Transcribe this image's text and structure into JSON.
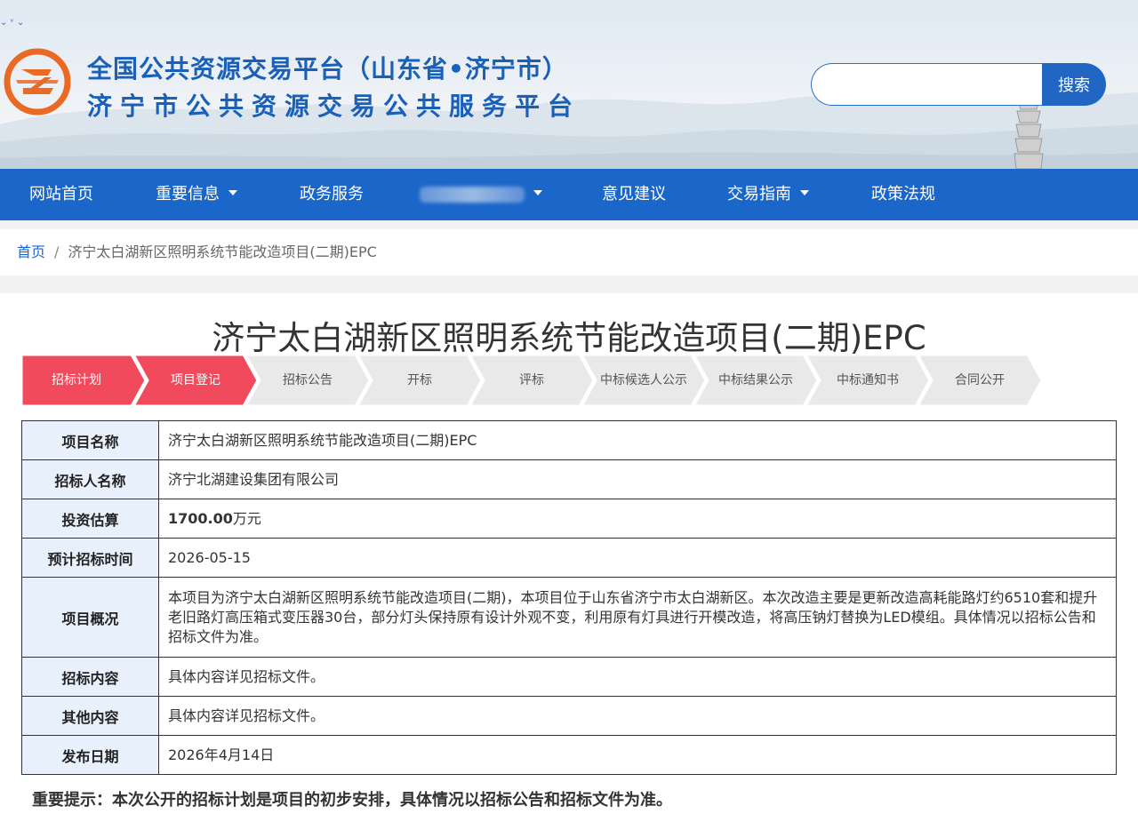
{
  "header": {
    "title_line1": "全国公共资源交易平台（山东省•济宁市）",
    "title_line2": "济宁市公共资源交易公共服务平台",
    "search": {
      "placeholder": "",
      "button_label": "搜索"
    }
  },
  "nav": {
    "items": [
      {
        "label": "网站首页",
        "dropdown": false
      },
      {
        "label": "重要信息",
        "dropdown": true
      },
      {
        "label": "政务服务",
        "dropdown": false
      },
      {
        "label": "",
        "dropdown": true,
        "obscured": true
      },
      {
        "label": "意见建议",
        "dropdown": false
      },
      {
        "label": "交易指南",
        "dropdown": true
      },
      {
        "label": "政策法规",
        "dropdown": false
      }
    ]
  },
  "breadcrumb": {
    "home": "首页",
    "separator": "/",
    "current": "济宁太白湖新区照明系统节能改造项目(二期)EPC"
  },
  "page": {
    "title": "济宁太白湖新区照明系统节能改造项目(二期)EPC"
  },
  "steps": {
    "active_color": "#f04a5c",
    "inactive_color": "#e9e9e9",
    "items": [
      {
        "label": "招标计划",
        "active": true
      },
      {
        "label": "项目登记",
        "active": true
      },
      {
        "label": "招标公告",
        "active": false
      },
      {
        "label": "开标",
        "active": false
      },
      {
        "label": "评标",
        "active": false
      },
      {
        "label": "中标候选人公示",
        "active": false
      },
      {
        "label": "中标结果公示",
        "active": false
      },
      {
        "label": "中标通知书",
        "active": false
      },
      {
        "label": "合同公开",
        "active": false
      }
    ]
  },
  "info": {
    "project_name": {
      "label": "项目名称",
      "value": "济宁太白湖新区照明系统节能改造项目(二期)EPC"
    },
    "tenderer": {
      "label": "招标人名称",
      "value": "济宁北湖建设集团有限公司"
    },
    "investment": {
      "label": "投资估算",
      "amount": "1700.00",
      "unit": "万元"
    },
    "planned_time": {
      "label": "预计招标时间",
      "value": "2026-05-15"
    },
    "overview": {
      "label": "项目概况",
      "value": "本项目为济宁太白湖新区照明系统节能改造项目(二期)，本项目位于山东省济宁市太白湖新区。本次改造主要是更新改造高耗能路灯约6510套和提升老旧路灯高压箱式变压器30台，部分灯头保持原有设计外观不变，利用原有灯具进行开模改造，将高压钠灯替换为LED模组。具体情况以招标公告和招标文件为准。"
    },
    "content": {
      "label": "招标内容",
      "value": "具体内容详见招标文件。"
    },
    "other": {
      "label": "其他内容",
      "value": "具体内容详见招标文件。"
    },
    "publish_date": {
      "label": "发布日期",
      "value": "2026年4月14日"
    }
  },
  "notice": "重要提示：本次公开的招标计划是项目的初步安排，具体情况以招标公告和招标文件为准。"
}
